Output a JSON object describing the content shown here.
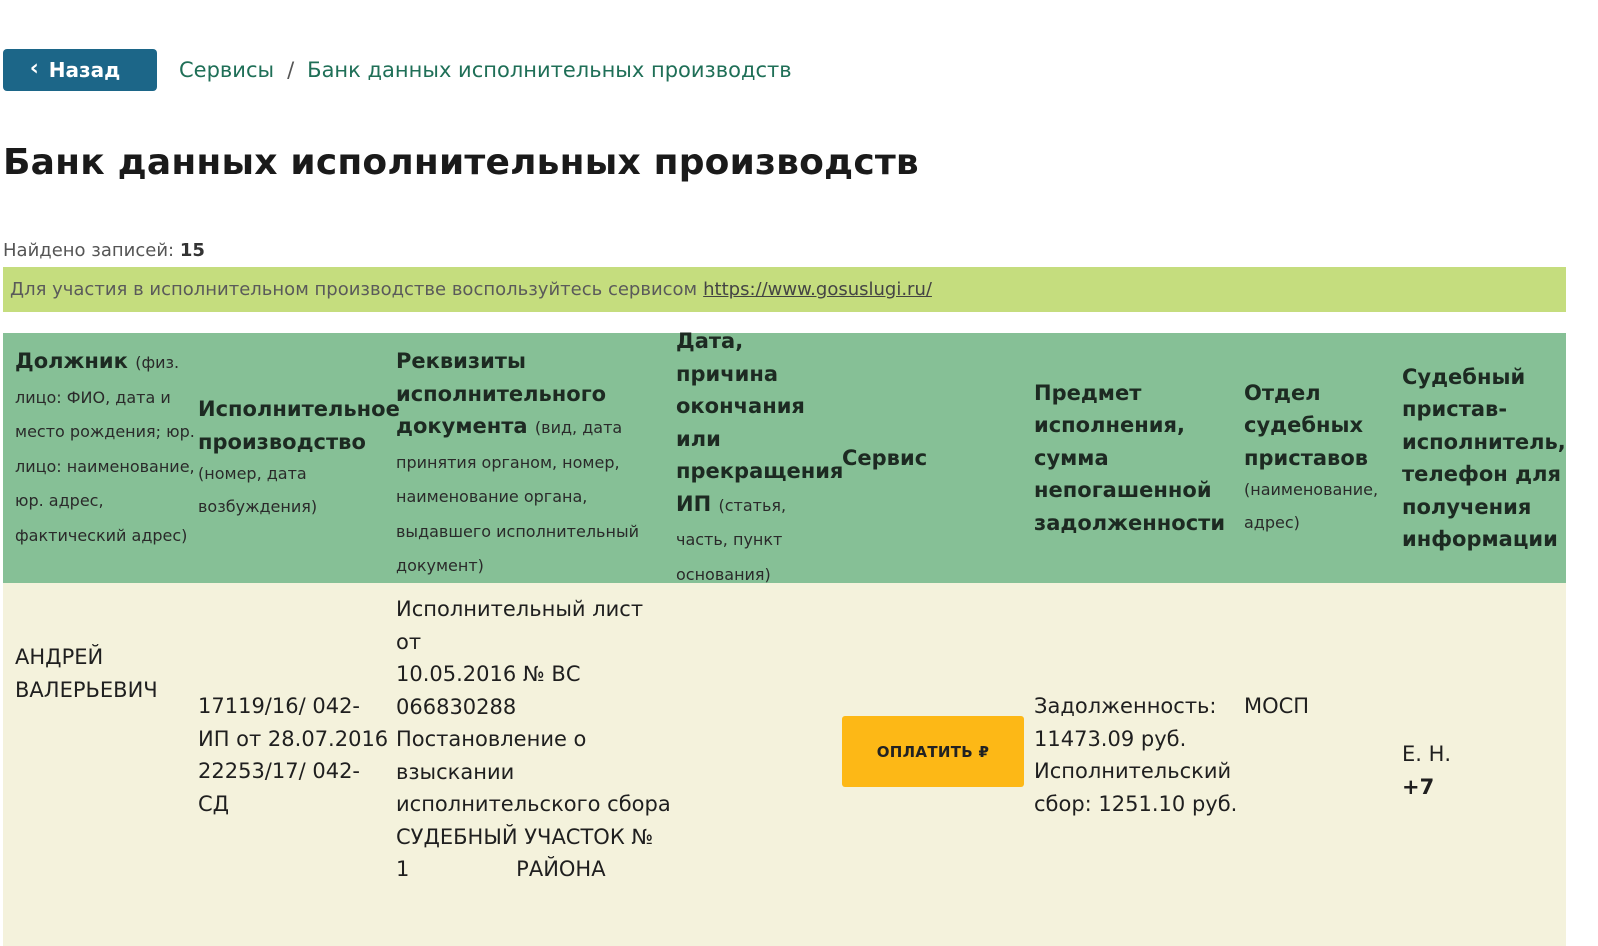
{
  "nav": {
    "back_label": "Назад",
    "breadcrumb": [
      "Сервисы",
      "Банк данных исполнительных производств"
    ],
    "breadcrumb_sep": "/"
  },
  "page": {
    "title": "Банк данных исполнительных производств",
    "found_label": "Найдено записей:",
    "found_count": "15",
    "banner_text": "Для участия в исполнительном производстве воспользуйтесь сервисом",
    "banner_link": "https://www.gosuslugi.ru/"
  },
  "colors": {
    "back_button": "#1c6688",
    "header_bg": "#86c096",
    "row_bg": "#f4f2dc",
    "banner_bg": "#c5dd7e",
    "pay_button": "#fdb816",
    "breadcrumb_link": "#1f6f57"
  },
  "table": {
    "headers": [
      {
        "main": "Должник",
        "sub": "(физ. лицо: ФИО, дата и место рождения; юр. лицо: наименование, юр. адрес, фактический адрес)"
      },
      {
        "main": "Исполнительное производство",
        "sub": "(номер, дата возбуждения)"
      },
      {
        "main": "Реквизиты исполнительного документа",
        "sub": "(вид, дата принятия органом, номер, наименование органа, выдавшего исполнительный документ)"
      },
      {
        "main": "Дата, причина окончания или прекращения ИП",
        "sub": "(статья, часть, пункт основания)"
      },
      {
        "main": "Сервис",
        "sub": ""
      },
      {
        "main": "Предмет исполнения, сумма непогашенной задолженности",
        "sub": ""
      },
      {
        "main": "Отдел судебных приставов",
        "sub": "(наименование, адрес)"
      },
      {
        "main": "Судебный пристав-исполнитель, телефон для получения информации",
        "sub": ""
      }
    ],
    "row": {
      "debtor": [
        "АНДРЕЙ",
        "ВАЛЕРЬЕВИЧ"
      ],
      "proceeding": [
        "17119/16/ 042-",
        "ИП от 28.07.2016",
        "22253/17/ 042-",
        "СД"
      ],
      "document": [
        "Исполнительный лист от",
        "10.05.2016 № ВС",
        "066830288",
        "Постановление о",
        "взыскании",
        "исполнительского сбора",
        "СУДЕБНЫЙ УЧАСТОК №",
        "1                РАЙОНА"
      ],
      "end_reason": "",
      "service_button": "ОПЛАТИТЬ ₽",
      "subject": [
        "Задолженность:",
        "11473.09 руб.",
        "Исполнительский",
        "сбор: 1251.10 руб."
      ],
      "department": "МОСП",
      "bailiff": [
        "Е. Н.",
        "+7"
      ]
    }
  }
}
